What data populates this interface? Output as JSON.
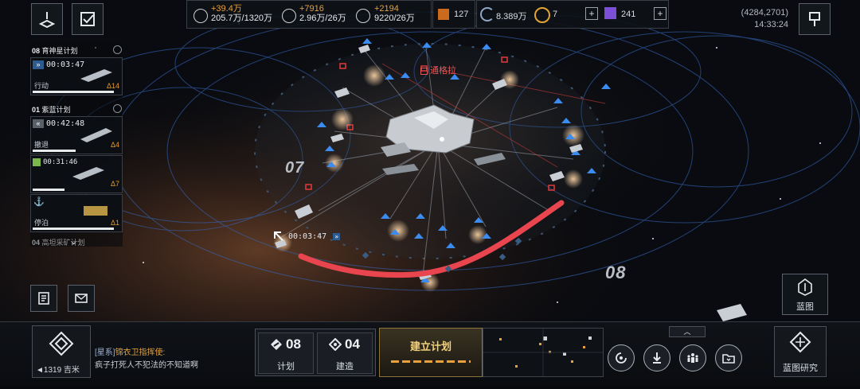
{
  "resources": [
    {
      "increase": "+39.4万",
      "amount": "205.7万/1320万"
    },
    {
      "increase": "+7916",
      "amount": "2.96万/26万"
    },
    {
      "increase": "+2194",
      "amount": "9220/26万"
    }
  ],
  "currency": {
    "fleet_count": "127",
    "credits": "8.389万",
    "tokens": "7",
    "premium": "241"
  },
  "status": {
    "coordinates": "(4284,2701)",
    "time": "14:33:24"
  },
  "tasks": {
    "group1": {
      "index": "08",
      "name": "育神星计划"
    },
    "task1": {
      "timer": "00:03:47",
      "status": "行动",
      "level": "14"
    },
    "group2": {
      "index": "01",
      "name": "紫蓝计划"
    },
    "task2": {
      "timer": "00:42:48",
      "status": "撤退",
      "level": "4"
    },
    "task3": {
      "timer": "00:31:46",
      "level": "7"
    },
    "task4": {
      "status": "停泊",
      "level": "1"
    },
    "group3": {
      "index": "04",
      "name": "高坦采矿计划"
    }
  },
  "map": {
    "target_name": "通格拉",
    "zone_left": "07",
    "zone_right": "08",
    "fleet_timer": "00:03:47"
  },
  "chat": {
    "channel": "[星系]",
    "sender": "锦衣卫指挥使:",
    "message": "疯子打死人不犯法的不知道啊"
  },
  "distance": "◄1319 吉米",
  "counters": {
    "plan_count": "08",
    "plan_label": "计划",
    "build_count": "04",
    "build_label": "建造"
  },
  "build_plan_button": "建立计划",
  "blueprint_label": "蓝图",
  "blueprint_research_label": "蓝图研究",
  "colors": {
    "accent": "#e9a23b",
    "hostile": "#e23a3a",
    "ally": "#3c8cf0"
  },
  "icons": [
    "beacon-icon",
    "task-icon",
    "fuel-icon",
    "crystal-icon",
    "gas-icon",
    "fleet-icon",
    "credits-icon",
    "token-icon",
    "premium-icon",
    "flag-icon",
    "mail-icon",
    "notes-icon",
    "radar-icon",
    "galaxy-icon",
    "download-icon",
    "group-icon",
    "folder-icon",
    "blueprint-icon"
  ]
}
